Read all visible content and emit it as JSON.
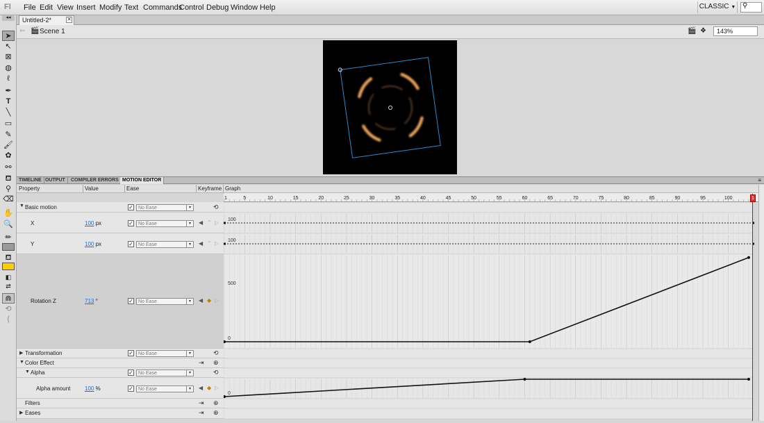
{
  "app": {
    "logo": "Fl",
    "workspace": "CLASSIC"
  },
  "menu": [
    "File",
    "Edit",
    "View",
    "Insert",
    "Modify",
    "Text",
    "Commands",
    "Control",
    "Debug",
    "Window",
    "Help"
  ],
  "document": {
    "tab_title": "Untitled-2*",
    "scene": "Scene 1",
    "zoom": "143%"
  },
  "panel_tabs": [
    "TIMELINE",
    "OUTPUT",
    "COMPILER ERRORS",
    "MOTION EDITOR"
  ],
  "motion_editor": {
    "headers": {
      "property": "Property",
      "value": "Value",
      "ease": "Ease",
      "keyframe": "Keyframe",
      "graph": "Graph"
    },
    "ruler_labels": [
      "1",
      "5",
      "10",
      "15",
      "20",
      "25",
      "30",
      "35",
      "40",
      "45",
      "50",
      "55",
      "60",
      "65",
      "70",
      "75",
      "80",
      "85",
      "90",
      "95",
      "100"
    ],
    "current_frame": "1",
    "rows": {
      "basic_motion": {
        "label": "Basic motion",
        "ease": "No Ease"
      },
      "x": {
        "label": "X",
        "value": "100",
        "unit": "px",
        "ease": "No Ease",
        "graph_label": "100"
      },
      "y": {
        "label": "Y",
        "value": "100",
        "unit": "px",
        "ease": "No Ease",
        "graph_label": "100"
      },
      "rotation": {
        "label": "Rotation Z",
        "value": "713",
        "unit": "°",
        "ease": "No Ease",
        "graph_top": "500",
        "graph_zero": "0"
      },
      "transformation": {
        "label": "Transformation",
        "ease": "No Ease"
      },
      "color_effect": {
        "label": "Color Effect"
      },
      "alpha": {
        "label": "Alpha",
        "ease": "No Ease"
      },
      "alpha_amount": {
        "label": "Alpha amount",
        "value": "100",
        "unit": "%",
        "ease": "No Ease",
        "graph_zero": "0"
      },
      "filters": {
        "label": "Filters"
      },
      "eases": {
        "label": "Eases"
      }
    },
    "curves": {
      "rotation": [
        [
          1,
          0
        ],
        [
          61,
          0
        ],
        [
          104,
          713
        ]
      ],
      "alpha": [
        [
          1,
          0
        ],
        [
          60,
          100
        ],
        [
          104,
          100
        ]
      ]
    }
  },
  "colors": {
    "playhead": "#d01010",
    "bounding_box": "#2a8ad0",
    "value_link": "#1a6fd0",
    "ring": "#e8a05a"
  }
}
